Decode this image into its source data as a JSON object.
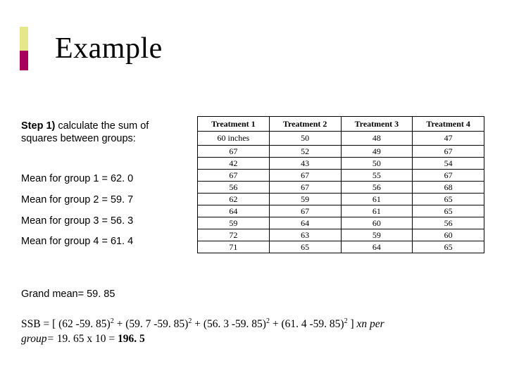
{
  "title": "Example",
  "step": {
    "label": "Step 1)",
    "body": " calculate the sum of squares between groups:"
  },
  "means": [
    "Mean for group 1 = 62. 0",
    "Mean for group 2 = 59. 7",
    "Mean for group 3 = 56. 3",
    "Mean for group 4 = 61. 4"
  ],
  "grand_mean": "Grand mean= 59. 85",
  "formula": {
    "lhs": "SSB = [",
    "t1": "(62 -59. 85)",
    "t2": "(59. 7 -59. 85)",
    "t3": "(56. 3 -59. 85)",
    "t4": "(61. 4 -59. 85)",
    "sup": "2",
    "plus": " + ",
    "close": " ] ",
    "tail_ital": "xn per",
    "line2a": "group= ",
    "line2b": "19. 65 x 10 = ",
    "result": "196. 5"
  },
  "table": {
    "headers": [
      "Treatment 1",
      "Treatment 2",
      "Treatment 3",
      "Treatment 4"
    ],
    "subheaders": [
      "60 inches",
      "50",
      "48",
      "47"
    ],
    "rows": [
      [
        "67",
        "52",
        "49",
        "67"
      ],
      [
        "42",
        "43",
        "50",
        "54"
      ],
      [
        "67",
        "67",
        "55",
        "67"
      ],
      [
        "56",
        "67",
        "56",
        "68"
      ],
      [
        "62",
        "59",
        "61",
        "65"
      ],
      [
        "64",
        "67",
        "61",
        "65"
      ],
      [
        "59",
        "64",
        "60",
        "56"
      ],
      [
        "72",
        "63",
        "59",
        "60"
      ],
      [
        "71",
        "65",
        "64",
        "65"
      ]
    ]
  },
  "chart_data": {
    "type": "table",
    "title": "Example — sum of squares between groups",
    "columns": [
      "Treatment 1",
      "Treatment 2",
      "Treatment 3",
      "Treatment 4"
    ],
    "column_subheaders": [
      "60 inches",
      "50",
      "48",
      "47"
    ],
    "data": [
      [
        67,
        52,
        49,
        67
      ],
      [
        42,
        43,
        50,
        54
      ],
      [
        67,
        67,
        55,
        67
      ],
      [
        56,
        67,
        56,
        68
      ],
      [
        62,
        59,
        61,
        65
      ],
      [
        64,
        67,
        61,
        65
      ],
      [
        59,
        64,
        60,
        56
      ],
      [
        72,
        63,
        59,
        60
      ],
      [
        71,
        65,
        64,
        65
      ]
    ],
    "group_means": [
      62.0,
      59.7,
      56.3,
      61.4
    ],
    "grand_mean": 59.85,
    "n_per_group": 10,
    "SSB": 196.5
  }
}
